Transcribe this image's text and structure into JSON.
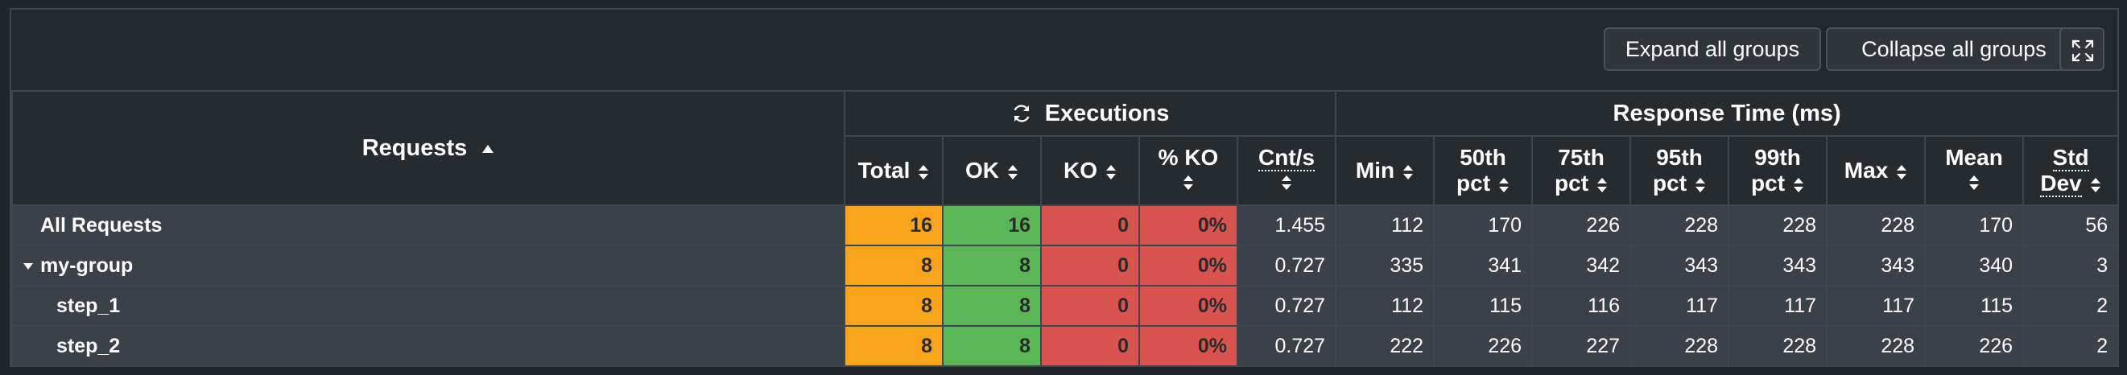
{
  "toolbar": {
    "expand_label": "Expand all groups",
    "collapse_label": "Collapse all groups",
    "fullscreen_icon": "expand-arrows-icon"
  },
  "table": {
    "requests_header": "Requests",
    "executions_header": "Executions",
    "response_time_header": "Response Time (ms)",
    "columns": {
      "total": "Total",
      "ok": "OK",
      "ko": "KO",
      "pko": "% KO",
      "cnts": "Cnt/s",
      "min": "Min",
      "p50a": "50th",
      "p50b": "pct",
      "p75a": "75th",
      "p75b": "pct",
      "p95a": "95th",
      "p95b": "pct",
      "p99a": "99th",
      "p99b": "pct",
      "max": "Max",
      "mean": "Mean",
      "stda": "Std",
      "stdb": "Dev"
    },
    "rows": [
      {
        "name": "All Requests",
        "total": "16",
        "ok": "16",
        "ko": "0",
        "pko": "0%",
        "cnts": "1.455",
        "min": "112",
        "p50": "170",
        "p75": "226",
        "p95": "228",
        "p99": "228",
        "max": "228",
        "mean": "170",
        "std": "56"
      },
      {
        "name": "my-group",
        "total": "8",
        "ok": "8",
        "ko": "0",
        "pko": "0%",
        "cnts": "0.727",
        "min": "335",
        "p50": "341",
        "p75": "342",
        "p95": "343",
        "p99": "343",
        "max": "343",
        "mean": "340",
        "std": "3"
      },
      {
        "name": "step_1",
        "total": "8",
        "ok": "8",
        "ko": "0",
        "pko": "0%",
        "cnts": "0.727",
        "min": "112",
        "p50": "115",
        "p75": "116",
        "p95": "117",
        "p99": "117",
        "max": "117",
        "mean": "115",
        "std": "2"
      },
      {
        "name": "step_2",
        "total": "8",
        "ok": "8",
        "ko": "0",
        "pko": "0%",
        "cnts": "0.727",
        "min": "222",
        "p50": "226",
        "p75": "227",
        "p95": "228",
        "p99": "228",
        "max": "228",
        "mean": "226",
        "std": "2"
      }
    ]
  },
  "colors": {
    "total": "#f7a31b",
    "ok": "#5bb658",
    "ko": "#d9534f",
    "background": "#22272c"
  }
}
